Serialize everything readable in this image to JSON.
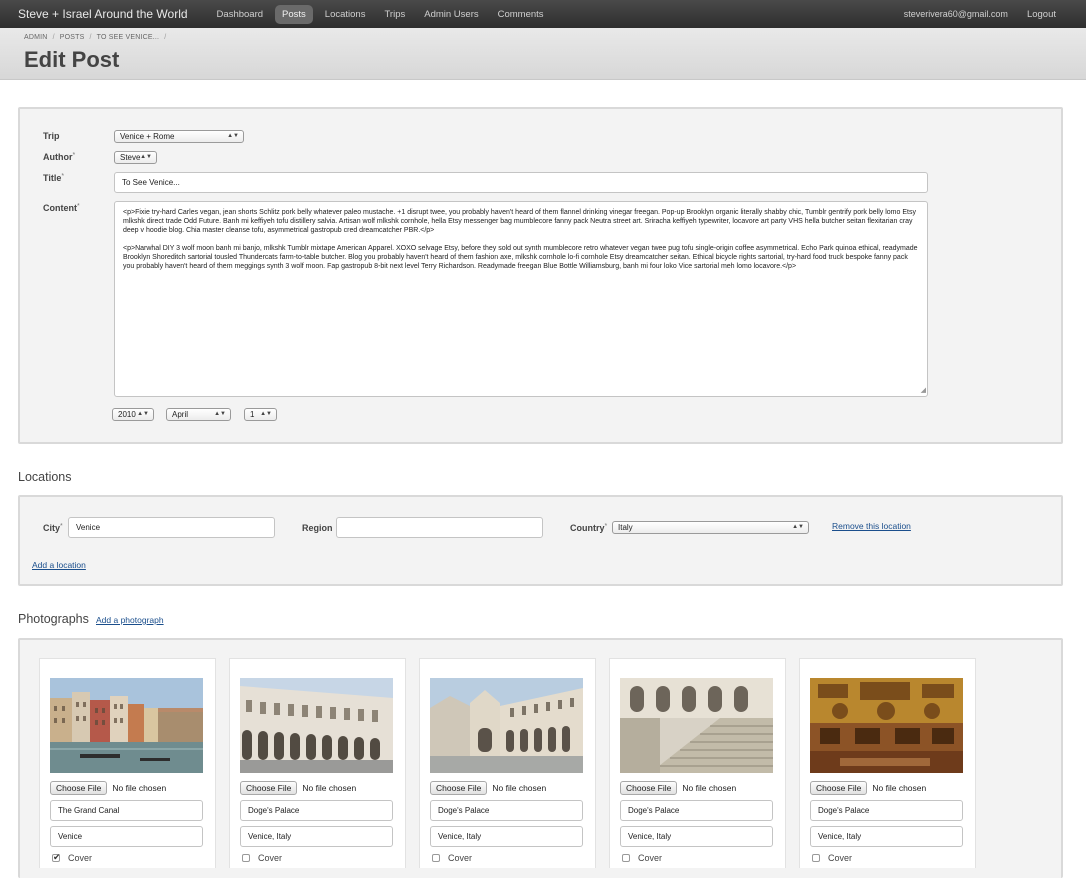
{
  "nav": {
    "brand": "Steve + Israel Around the World",
    "items": [
      "Dashboard",
      "Posts",
      "Locations",
      "Trips",
      "Admin Users",
      "Comments"
    ],
    "user_email": "steverivera60@gmail.com",
    "logout": "Logout"
  },
  "breadcrumb": [
    "ADMIN",
    "POSTS",
    "TO SEE VENICE...",
    ""
  ],
  "page_title": "Edit Post",
  "form": {
    "trip_label": "Trip",
    "trip_value": "Venice + Rome",
    "author_label": "Author",
    "author_value": "Steve",
    "title_label": "Title",
    "title_value": "To See Venice...",
    "content_label": "Content",
    "content_p1": "<p>Fixie try-hard Carles vegan, jean shorts Schlitz pork belly whatever paleo mustache. +1 disrupt twee, you probably haven't heard of them flannel drinking vinegar freegan. Pop-up Brooklyn organic literally shabby chic, Tumblr gentrify pork belly lomo Etsy mlkshk direct trade Odd Future. Banh mi keffiyeh tofu distillery salvia. Artisan wolf mlkshk cornhole, hella Etsy messenger bag mumblecore fanny pack Neutra street art. Sriracha keffiyeh typewriter, locavore art party VHS hella butcher seitan flexitarian cray deep v hoodie blog. Chia master cleanse tofu, asymmetrical gastropub cred dreamcatcher PBR.</p>",
    "content_p2": "<p>Narwhal DIY 3 wolf moon banh mi banjo, mlkshk Tumblr mixtape American Apparel. XOXO selvage Etsy, before they sold out synth mumblecore retro whatever vegan twee pug tofu single-origin coffee asymmetrical. Echo Park quinoa ethical, readymade Brooklyn Shoreditch sartorial tousled Thundercats farm-to-table butcher. Blog you probably haven't heard of them fashion axe, mlkshk cornhole lo-fi cornhole Etsy dreamcatcher seitan. Ethical bicycle rights sartorial, try-hard food truck bespoke fanny pack you probably haven't heard of them meggings synth 3 wolf moon. Fap gastropub 8-bit next level Terry Richardson. Readymade freegan Blue Bottle Williamsburg, banh mi four loko Vice sartorial meh lomo locavore.</p>",
    "date_year": "2010",
    "date_month": "April",
    "date_day": "1"
  },
  "locations": {
    "title": "Locations",
    "city_label": "City",
    "city_value": "Venice",
    "region_label": "Region",
    "region_value": "",
    "country_label": "Country",
    "country_value": "Italy",
    "remove_link": "Remove this location",
    "add_link": "Add a location"
  },
  "photographs": {
    "title": "Photographs",
    "add_link": "Add a photograph",
    "choose_file": "Choose File",
    "no_file": "No file chosen",
    "cover_label": "Cover",
    "items": [
      {
        "caption": "The Grand Canal",
        "place": "Venice",
        "cover": true
      },
      {
        "caption": "Doge's Palace",
        "place": "Venice, Italy",
        "cover": false
      },
      {
        "caption": "Doge's Palace",
        "place": "Venice, Italy",
        "cover": false
      },
      {
        "caption": "Doge's Palace",
        "place": "Venice, Italy",
        "cover": false
      },
      {
        "caption": "Doge's Palace",
        "place": "Venice, Italy",
        "cover": false
      }
    ]
  }
}
